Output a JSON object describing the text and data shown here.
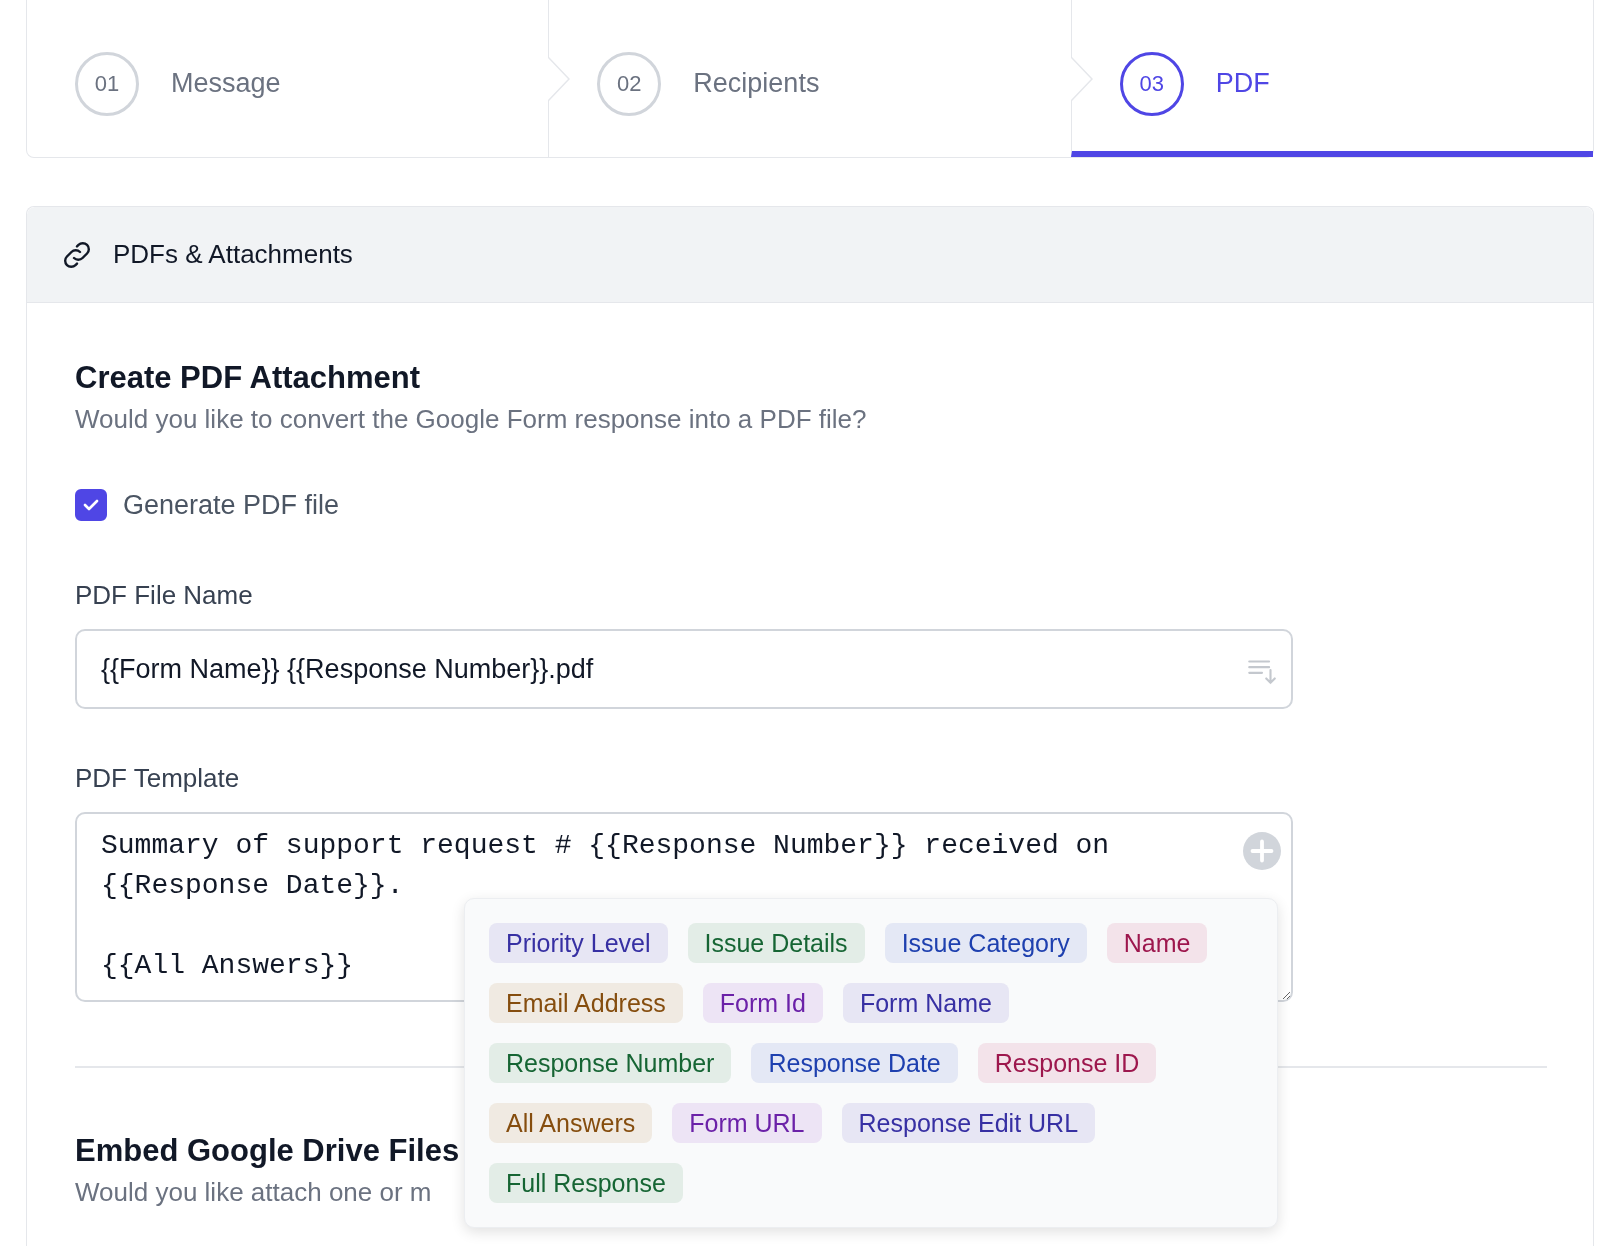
{
  "steps": [
    {
      "number": "01",
      "label": "Message",
      "selected": false
    },
    {
      "number": "02",
      "label": "Recipients",
      "selected": false
    },
    {
      "number": "03",
      "label": "PDF",
      "selected": true
    }
  ],
  "panel": {
    "title": "PDFs & Attachments"
  },
  "pdf_section": {
    "title": "Create PDF Attachment",
    "subtitle": "Would you like to convert the Google Form response into a PDF file?",
    "checkbox": {
      "label": "Generate PDF file",
      "checked": true
    },
    "file_name": {
      "label": "PDF File Name",
      "value": "{{Form Name}} {{Response Number}}.pdf"
    },
    "template": {
      "label": "PDF Template",
      "value": "Summary of support request # {{Response Number}} received on {{Response Date}}.\n\n{{All Answers}}"
    }
  },
  "tag_menu": [
    {
      "label": "Priority Level",
      "color": "#3730a3"
    },
    {
      "label": "Issue Details",
      "color": "#166534"
    },
    {
      "label": "Issue Category",
      "color": "#1e40af"
    },
    {
      "label": "Name",
      "color": "#9d174d"
    },
    {
      "label": "Email Address",
      "color": "#854d0e"
    },
    {
      "label": "Form Id",
      "color": "#6b21a8"
    },
    {
      "label": "Form Name",
      "color": "#3730a3"
    },
    {
      "label": "Response Number",
      "color": "#166534"
    },
    {
      "label": "Response Date",
      "color": "#1e40af"
    },
    {
      "label": "Response ID",
      "color": "#9d174d"
    },
    {
      "label": "All Answers",
      "color": "#854d0e"
    },
    {
      "label": "Form URL",
      "color": "#6b21a8"
    },
    {
      "label": "Response Edit URL",
      "color": "#3730a3"
    },
    {
      "label": "Full Response",
      "color": "#166534"
    }
  ],
  "drive_section": {
    "title": "Embed Google Drive Files",
    "subtitle": "Would you like attach one or m"
  }
}
